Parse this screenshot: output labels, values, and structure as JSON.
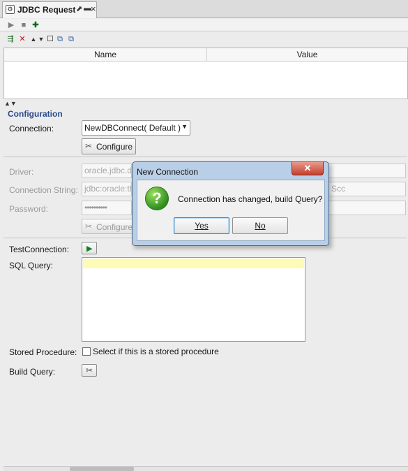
{
  "tab": {
    "title": "JDBC Request",
    "close": "×",
    "icon": "jdbc-icon"
  },
  "table": {
    "col_name": "Name",
    "col_value": "Value"
  },
  "config": {
    "section_title": "Configuration",
    "connection_label": "Connection:",
    "connection_value": "NewDBConnect( Default )",
    "configure_label": "Configure",
    "driver_label": "Driver:",
    "driver_value": "oracle.jdbc.d",
    "driver_suffix": "",
    "connstr_label": "Connection String:",
    "connstr_value": "jdbc:oracle:th",
    "connstr_suffix": "Scc",
    "password_label": "Password:",
    "password_value": "••••••••••",
    "configure2_label": "Configure",
    "test_label": "TestConnection:",
    "sql_label": "SQL Query:",
    "stored_label": "Stored Procedure:",
    "stored_check_label": "Select if this is a stored procedure",
    "build_label": "Build Query:"
  },
  "dialog": {
    "title": "New Connection",
    "close": "✕",
    "message": "Connection has changed, build Query?",
    "yes": "Yes",
    "no": "No",
    "icon": "question-icon"
  }
}
